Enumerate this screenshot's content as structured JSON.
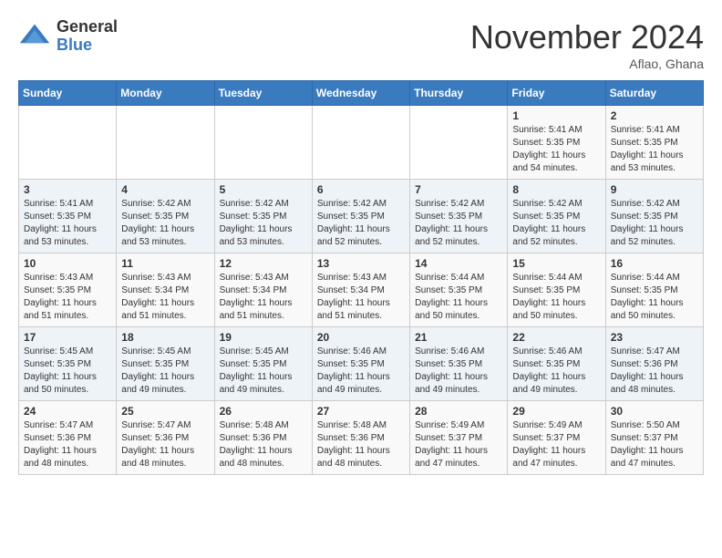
{
  "header": {
    "logo_line1": "General",
    "logo_line2": "Blue",
    "month_title": "November 2024",
    "location": "Aflao, Ghana"
  },
  "weekdays": [
    "Sunday",
    "Monday",
    "Tuesday",
    "Wednesday",
    "Thursday",
    "Friday",
    "Saturday"
  ],
  "weeks": [
    [
      {
        "day": "",
        "info": ""
      },
      {
        "day": "",
        "info": ""
      },
      {
        "day": "",
        "info": ""
      },
      {
        "day": "",
        "info": ""
      },
      {
        "day": "",
        "info": ""
      },
      {
        "day": "1",
        "info": "Sunrise: 5:41 AM\nSunset: 5:35 PM\nDaylight: 11 hours\nand 54 minutes."
      },
      {
        "day": "2",
        "info": "Sunrise: 5:41 AM\nSunset: 5:35 PM\nDaylight: 11 hours\nand 53 minutes."
      }
    ],
    [
      {
        "day": "3",
        "info": "Sunrise: 5:41 AM\nSunset: 5:35 PM\nDaylight: 11 hours\nand 53 minutes."
      },
      {
        "day": "4",
        "info": "Sunrise: 5:42 AM\nSunset: 5:35 PM\nDaylight: 11 hours\nand 53 minutes."
      },
      {
        "day": "5",
        "info": "Sunrise: 5:42 AM\nSunset: 5:35 PM\nDaylight: 11 hours\nand 53 minutes."
      },
      {
        "day": "6",
        "info": "Sunrise: 5:42 AM\nSunset: 5:35 PM\nDaylight: 11 hours\nand 52 minutes."
      },
      {
        "day": "7",
        "info": "Sunrise: 5:42 AM\nSunset: 5:35 PM\nDaylight: 11 hours\nand 52 minutes."
      },
      {
        "day": "8",
        "info": "Sunrise: 5:42 AM\nSunset: 5:35 PM\nDaylight: 11 hours\nand 52 minutes."
      },
      {
        "day": "9",
        "info": "Sunrise: 5:42 AM\nSunset: 5:35 PM\nDaylight: 11 hours\nand 52 minutes."
      }
    ],
    [
      {
        "day": "10",
        "info": "Sunrise: 5:43 AM\nSunset: 5:35 PM\nDaylight: 11 hours\nand 51 minutes."
      },
      {
        "day": "11",
        "info": "Sunrise: 5:43 AM\nSunset: 5:34 PM\nDaylight: 11 hours\nand 51 minutes."
      },
      {
        "day": "12",
        "info": "Sunrise: 5:43 AM\nSunset: 5:34 PM\nDaylight: 11 hours\nand 51 minutes."
      },
      {
        "day": "13",
        "info": "Sunrise: 5:43 AM\nSunset: 5:34 PM\nDaylight: 11 hours\nand 51 minutes."
      },
      {
        "day": "14",
        "info": "Sunrise: 5:44 AM\nSunset: 5:35 PM\nDaylight: 11 hours\nand 50 minutes."
      },
      {
        "day": "15",
        "info": "Sunrise: 5:44 AM\nSunset: 5:35 PM\nDaylight: 11 hours\nand 50 minutes."
      },
      {
        "day": "16",
        "info": "Sunrise: 5:44 AM\nSunset: 5:35 PM\nDaylight: 11 hours\nand 50 minutes."
      }
    ],
    [
      {
        "day": "17",
        "info": "Sunrise: 5:45 AM\nSunset: 5:35 PM\nDaylight: 11 hours\nand 50 minutes."
      },
      {
        "day": "18",
        "info": "Sunrise: 5:45 AM\nSunset: 5:35 PM\nDaylight: 11 hours\nand 49 minutes."
      },
      {
        "day": "19",
        "info": "Sunrise: 5:45 AM\nSunset: 5:35 PM\nDaylight: 11 hours\nand 49 minutes."
      },
      {
        "day": "20",
        "info": "Sunrise: 5:46 AM\nSunset: 5:35 PM\nDaylight: 11 hours\nand 49 minutes."
      },
      {
        "day": "21",
        "info": "Sunrise: 5:46 AM\nSunset: 5:35 PM\nDaylight: 11 hours\nand 49 minutes."
      },
      {
        "day": "22",
        "info": "Sunrise: 5:46 AM\nSunset: 5:35 PM\nDaylight: 11 hours\nand 49 minutes."
      },
      {
        "day": "23",
        "info": "Sunrise: 5:47 AM\nSunset: 5:36 PM\nDaylight: 11 hours\nand 48 minutes."
      }
    ],
    [
      {
        "day": "24",
        "info": "Sunrise: 5:47 AM\nSunset: 5:36 PM\nDaylight: 11 hours\nand 48 minutes."
      },
      {
        "day": "25",
        "info": "Sunrise: 5:47 AM\nSunset: 5:36 PM\nDaylight: 11 hours\nand 48 minutes."
      },
      {
        "day": "26",
        "info": "Sunrise: 5:48 AM\nSunset: 5:36 PM\nDaylight: 11 hours\nand 48 minutes."
      },
      {
        "day": "27",
        "info": "Sunrise: 5:48 AM\nSunset: 5:36 PM\nDaylight: 11 hours\nand 48 minutes."
      },
      {
        "day": "28",
        "info": "Sunrise: 5:49 AM\nSunset: 5:37 PM\nDaylight: 11 hours\nand 47 minutes."
      },
      {
        "day": "29",
        "info": "Sunrise: 5:49 AM\nSunset: 5:37 PM\nDaylight: 11 hours\nand 47 minutes."
      },
      {
        "day": "30",
        "info": "Sunrise: 5:50 AM\nSunset: 5:37 PM\nDaylight: 11 hours\nand 47 minutes."
      }
    ]
  ]
}
